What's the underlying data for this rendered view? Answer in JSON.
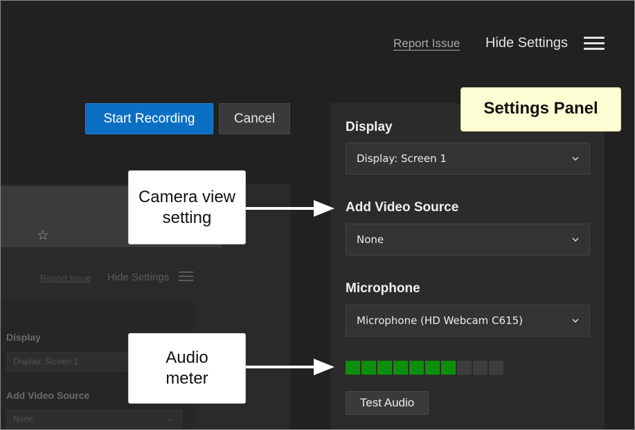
{
  "topbar": {
    "report_issue": "Report Issue",
    "hide_settings": "Hide Settings"
  },
  "actions": {
    "start_recording": "Start Recording",
    "cancel": "Cancel"
  },
  "settings": {
    "display": {
      "label": "Display",
      "value": "Display: Screen 1"
    },
    "video_source": {
      "label": "Add Video Source",
      "value": "None"
    },
    "microphone": {
      "label": "Microphone",
      "value": "Microphone (HD Webcam C615)"
    },
    "audio_meter": {
      "segments_total": 10,
      "segments_active": 7,
      "active_color": "#0d8f0d",
      "inactive_color": "#3d3d3d"
    },
    "test_audio": "Test Audio"
  },
  "preview": {
    "report_issue": "Report Issue",
    "hide_settings": "Hide Settings",
    "display_label": "Display",
    "display_value": "Display: Screen 1",
    "video_label": "Add Video Source",
    "video_value": "None"
  },
  "callouts": {
    "settings_panel": "Settings Panel",
    "camera_line1": "Camera view",
    "camera_line2": "setting",
    "audio_line1": "Audio",
    "audio_line2": "meter"
  },
  "icons": {
    "menu": "hamburger-menu-icon",
    "dropdown": "chevron-down-icon",
    "favorite": "star-icon"
  },
  "colors": {
    "accent": "#0b6fc4",
    "background": "#212121",
    "panel": "#2b2b2b",
    "callout_highlight": "#fdfdd3"
  }
}
